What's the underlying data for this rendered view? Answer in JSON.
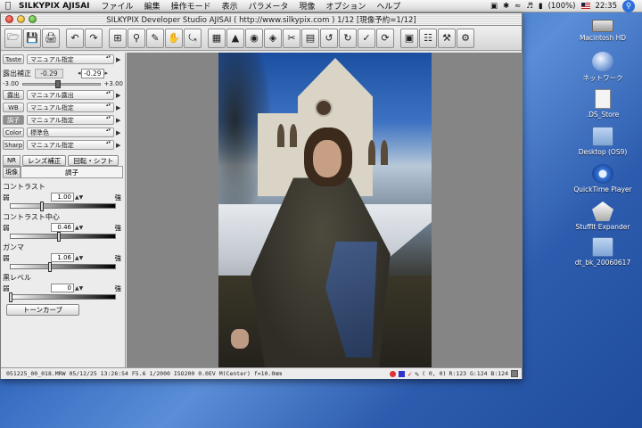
{
  "menubar": {
    "app_name": "SILKYPIX AJISAI",
    "items": [
      "ファイル",
      "編集",
      "操作モード",
      "表示",
      "パラメータ",
      "現像",
      "オプション",
      "ヘルプ"
    ],
    "battery": "(100%)",
    "clock": "22:35"
  },
  "window": {
    "title": "SILKYPIX Developer Studio AJISAI ( http://www.silkypix.com )  1/12 [現像予約=1/12]"
  },
  "toolbar": {
    "buttons": [
      "open-folder-icon",
      "save-icon",
      "print-icon",
      "undo-icon",
      "redo-icon",
      "crop-icon",
      "zoom-icon",
      "pen-icon",
      "hand-icon",
      "rotate-icon",
      "tone-icon",
      "sharpen-icon",
      "nr-icon",
      "color-icon",
      "cut-icon",
      "levels-icon",
      "rotate-left-icon",
      "rotate-right-icon",
      "check-icon",
      "refresh-icon",
      "develop-icon",
      "batch-icon",
      "tools-icon",
      "settings-icon"
    ]
  },
  "leftpanel": {
    "taste": {
      "label": "Taste",
      "value": "マニュアル指定"
    },
    "exposure": {
      "label": "露出補正",
      "display_value": "-0.29",
      "input_value": "-0.29",
      "min_label": "-3.00",
      "max_label": "+3.00",
      "level": -0.29
    },
    "params": [
      {
        "label": "露出",
        "value": "マニュアル露出"
      },
      {
        "label": "WB",
        "value": "マニュアル指定"
      },
      {
        "label": "調子",
        "value": "マニュアル指定"
      },
      {
        "label": "Color",
        "value": "標準色"
      },
      {
        "label": "Sharp",
        "value": "マニュアル指定"
      }
    ],
    "nr_label": "NR",
    "lens_button": "レンズ補正",
    "rotate_button": "回転・シフト",
    "develop_tab": "現像",
    "section_title": "調子",
    "adjustments": [
      {
        "title": "コントラスト",
        "weak": "弱",
        "strong": "強",
        "value": "1.00",
        "level": 0.3
      },
      {
        "title": "コントラスト中心",
        "weak": "弱",
        "strong": "強",
        "value": "0.46",
        "level": 0.46
      },
      {
        "title": "ガンマ",
        "weak": "弱",
        "strong": "強",
        "value": "1.06",
        "level": 0.38
      },
      {
        "title": "黒レベル",
        "weak": "弱",
        "strong": "強",
        "value": "0",
        "level": 0.0
      }
    ],
    "tone_curve_button": "トーンカーブ"
  },
  "statusbar": {
    "file_info": "051225_00_018.MRW  05/12/25 13:26:54  F5.6 1/2000 ISO200   0.0EV M(Center)  f=10.0mm",
    "coords": "(     0,     0)",
    "rgb": "R:123 G:124 B:124"
  },
  "desktop": {
    "icons": [
      {
        "label": "Macintosh HD",
        "icon": "hard-drive-icon"
      },
      {
        "label": "ネットワーク",
        "icon": "network-icon"
      },
      {
        "label": ".DS_Store",
        "icon": "file-icon"
      },
      {
        "label": "Desktop (OS9)",
        "icon": "folder-icon"
      },
      {
        "label": "QuickTime Player",
        "icon": "quicktime-icon"
      },
      {
        "label": "StuffIt Expander",
        "icon": "stuffit-icon"
      },
      {
        "label": "dt_bk_20060617",
        "icon": "folder-icon"
      }
    ]
  }
}
